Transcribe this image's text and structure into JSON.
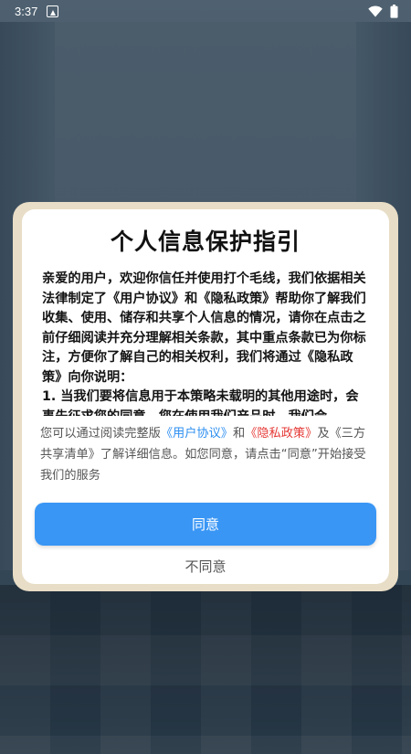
{
  "status_bar": {
    "time": "3:37",
    "icons": [
      "app-notification-icon",
      "wifi-icon",
      "battery-icon"
    ]
  },
  "dialog": {
    "title": "个人信息保护指引",
    "body": "亲爱的用户，欢迎你信任并使用打个毛线，我们依据相关法律制定了《用户协议》和《隐私政策》帮助你了解我们收集、使用、储存和共享个人信息的情况，请你在点击之前仔细阅读并充分理解相关条款，其中重点条款已为你标注，方便你了解自己的相关权利，我们将通过《隐私政策》向你说明：\n1. 当我们要将信息用于本策略未载明的其他用途时，会事先征求您的同意。您在使用我们产品时，我们会",
    "summary_prefix": "您可以通过阅读完整版",
    "user_agreement_link": "《用户协议》",
    "summary_and": "和",
    "privacy_policy_link": "《隐私政策》",
    "summary_suffix": "及《三方共享清单》了解详细信息。如您同意，请点击“同意”开始接受我们的服务",
    "agree_label": "同意",
    "disagree_label": "不同意"
  },
  "colors": {
    "link_blue": "#2e8ff0",
    "link_red": "#e53935",
    "agree_button": "#3996f5",
    "dialog_frame": "#e8ddc6"
  }
}
